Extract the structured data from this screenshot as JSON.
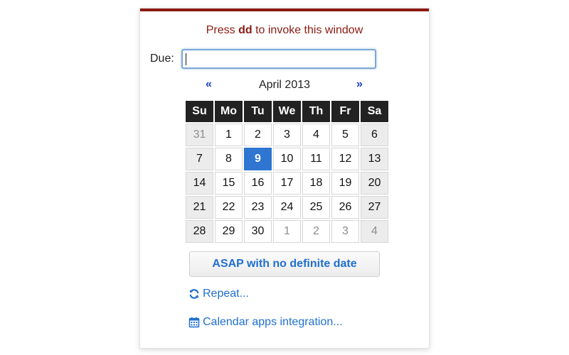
{
  "hint": {
    "prefix": "Press ",
    "key": "dd",
    "suffix": " to invoke this window"
  },
  "due": {
    "label": "Due:",
    "value": "",
    "placeholder": ""
  },
  "calendar": {
    "month_label": "April 2013",
    "prev_label": "«",
    "next_label": "»",
    "weekdays": [
      "Su",
      "Mo",
      "Tu",
      "We",
      "Th",
      "Fr",
      "Sa"
    ],
    "weeks": [
      [
        "31",
        "1",
        "2",
        "3",
        "4",
        "5",
        "6"
      ],
      [
        "7",
        "8",
        "9",
        "10",
        "11",
        "12",
        "13"
      ],
      [
        "14",
        "15",
        "16",
        "17",
        "18",
        "19",
        "20"
      ],
      [
        "21",
        "22",
        "23",
        "24",
        "25",
        "26",
        "27"
      ],
      [
        "28",
        "29",
        "30",
        "1",
        "2",
        "3",
        "4"
      ]
    ],
    "selected_day": "9"
  },
  "actions": {
    "asap_label": "ASAP with no definite date",
    "repeat_label": "Repeat...",
    "calendar_label": "Calendar apps integration..."
  },
  "icons": {
    "repeat": "refresh-icon",
    "calendar": "calendar-icon"
  },
  "colors": {
    "accent_dark_red": "#8b1a10",
    "link_blue": "#1f6fd0",
    "nav_blue": "#1a3fbf",
    "selected_blue": "#2f75d2",
    "header_black": "#222222",
    "weekend_gray": "#ececec"
  }
}
